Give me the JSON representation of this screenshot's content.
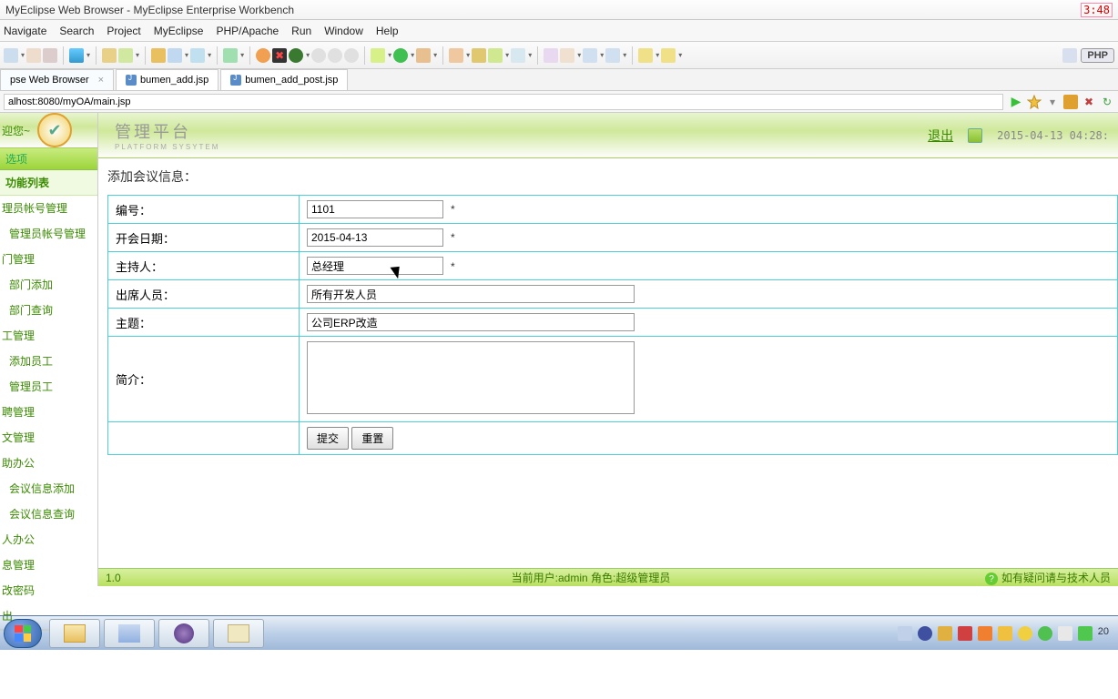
{
  "window": {
    "title": "MyEclipse Web Browser - MyEclipse Enterprise Workbench",
    "clock": "3:48"
  },
  "menu": [
    "Navigate",
    "Search",
    "Project",
    "MyEclipse",
    "PHP/Apache",
    "Run",
    "Window",
    "Help"
  ],
  "perspective": "PHP",
  "tabs": [
    {
      "label": "pse Web Browser",
      "jsp": false,
      "close": true
    },
    {
      "label": "bumen_add.jsp",
      "jsp": true,
      "close": false
    },
    {
      "label": "bumen_add_post.jsp",
      "jsp": true,
      "close": false
    }
  ],
  "address": "alhost:8080/myOA/main.jsp",
  "banner": {
    "welcome": "迎您~",
    "cn": "管理平台",
    "en": "PLATFORM SYSYTEM",
    "exit": "退出",
    "datetime": "2015-04-13 04:28:"
  },
  "sidebar": {
    "tab": "选项",
    "title": "功能列表",
    "items": [
      "理员帐号管理",
      "管理员帐号管理",
      "门管理",
      "部门添加",
      "部门查询",
      "工管理",
      "添加员工",
      "管理员工",
      "聘管理",
      "文管理",
      "助办公",
      "会议信息添加",
      "会议信息查询",
      "人办公",
      "息管理",
      "改密码",
      "出"
    ]
  },
  "form": {
    "title": "添加会议信息：",
    "fields": {
      "id_label": "编号：",
      "id_value": "1101",
      "date_label": "开会日期：",
      "date_value": "2015-04-13",
      "host_label": "主持人：",
      "host_value": "总经理",
      "att_label": "出席人员：",
      "att_value": "所有开发人员",
      "subj_label": "主题：",
      "subj_value": "公司ERP改造",
      "desc_label": "简介：",
      "desc_value": ""
    },
    "submit": "提交",
    "reset": "重置"
  },
  "status": {
    "ver": "1.0",
    "mid": "当前用户:admin  角色:超级管理员",
    "right": "如有疑问请与技术人员"
  },
  "tray_time": "20"
}
